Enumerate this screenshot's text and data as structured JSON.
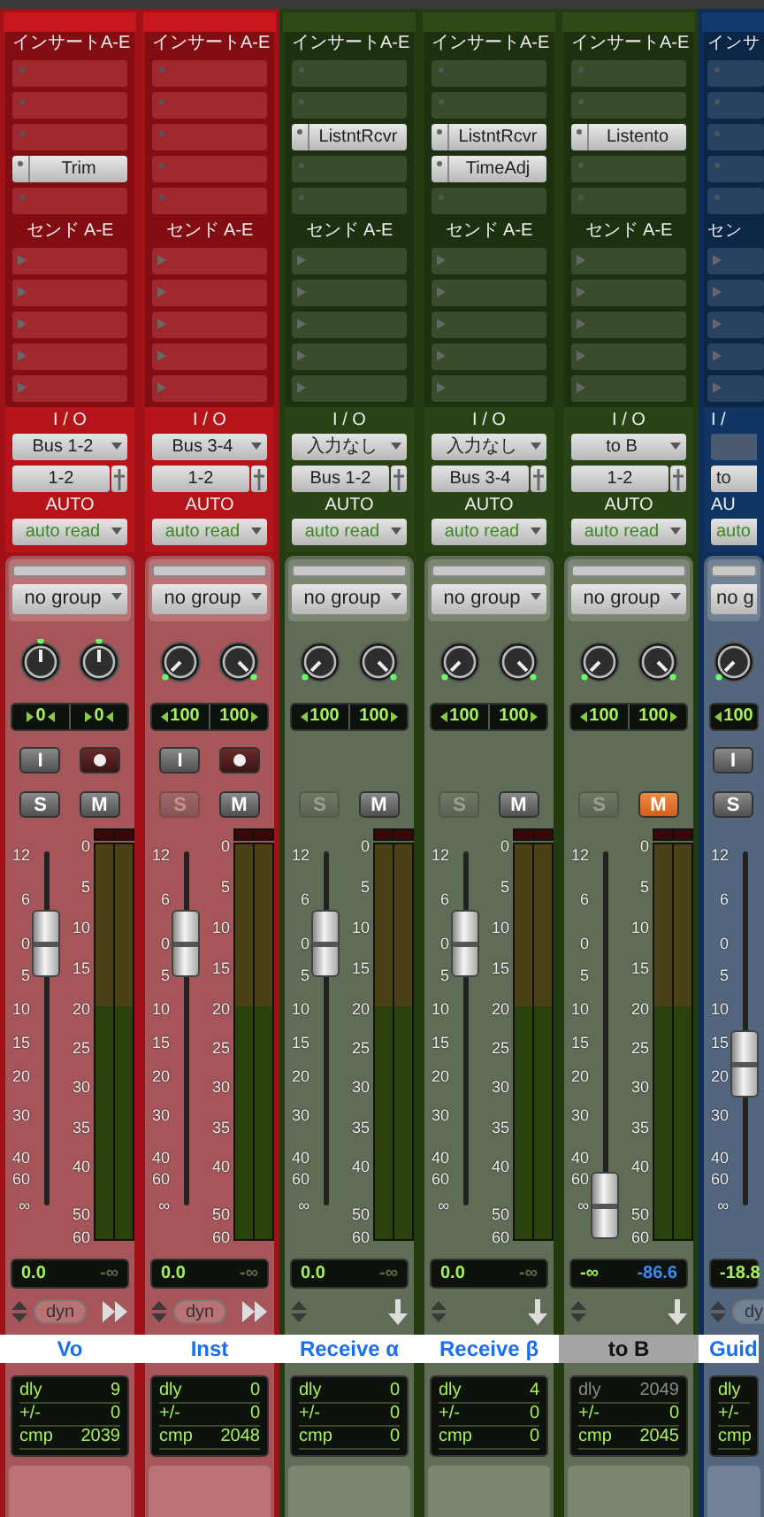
{
  "strips": [
    {
      "color": "#c8161d",
      "inserts_title": "インサートA-E",
      "inserts": [
        {
          "kind": "empty"
        },
        {
          "kind": "empty"
        },
        {
          "kind": "empty"
        },
        {
          "kind": "plugin",
          "label": "Trim"
        },
        {
          "kind": "empty"
        }
      ],
      "sends_title": "センド A-E",
      "sends": [
        {
          "kind": "empty"
        },
        {
          "kind": "empty"
        },
        {
          "kind": "empty"
        },
        {
          "kind": "empty"
        },
        {
          "kind": "empty"
        }
      ],
      "io_title": "I / O",
      "input": "Bus 1-2",
      "output": "1-2",
      "auto_title": "AUTO",
      "auto": "auto read",
      "group": "no group",
      "knobs": [
        {
          "kind": "center"
        },
        {
          "kind": "center"
        }
      ],
      "pan": [
        "0",
        "0"
      ],
      "buttons": [
        {
          "kind": "input",
          "label": "I"
        },
        {
          "kind": "record"
        }
      ],
      "solo": {
        "label": "S",
        "disabled": false
      },
      "mute": {
        "label": "M",
        "on": false
      },
      "fader_scale": [
        "12",
        "6",
        "0",
        "5",
        "10",
        "15",
        "20",
        "30",
        "40",
        "60",
        "∞"
      ],
      "meter_scale": [
        "0",
        "5",
        "10",
        "15",
        "20",
        "25",
        "30",
        "35",
        "40",
        "50",
        "60"
      ],
      "fader": {
        "level": 0.74
      },
      "volume": "0.0",
      "peak": "-∞",
      "peak_dimmed": true,
      "dyn": "dyn",
      "end_icon": {
        "kind": "double_arrow"
      },
      "name": "Vo",
      "selected": true,
      "delay": [
        {
          "label": "dly",
          "value": "9",
          "dimmed": false
        },
        {
          "label": "+/-",
          "value": "0",
          "dimmed": false
        },
        {
          "label": "cmp",
          "value": "2039",
          "dimmed": false
        }
      ]
    },
    {
      "color": "#c8161d",
      "inserts_title": "インサートA-E",
      "inserts": [
        {
          "kind": "empty"
        },
        {
          "kind": "empty"
        },
        {
          "kind": "empty"
        },
        {
          "kind": "empty"
        },
        {
          "kind": "empty"
        }
      ],
      "sends_title": "センド A-E",
      "sends": [
        {
          "kind": "empty"
        },
        {
          "kind": "empty"
        },
        {
          "kind": "empty"
        },
        {
          "kind": "empty"
        },
        {
          "kind": "empty"
        }
      ],
      "io_title": "I / O",
      "input": "Bus 3-4",
      "output": "1-2",
      "auto_title": "AUTO",
      "auto": "auto read",
      "group": "no group",
      "knobs": [
        {
          "kind": "left"
        },
        {
          "kind": "right"
        }
      ],
      "pan": [
        "100",
        "100"
      ],
      "buttons": [
        {
          "kind": "input",
          "label": "I"
        },
        {
          "kind": "record"
        }
      ],
      "solo": {
        "label": "S",
        "disabled": true
      },
      "mute": {
        "label": "M",
        "on": false
      },
      "fader_scale": [
        "12",
        "6",
        "0",
        "5",
        "10",
        "15",
        "20",
        "30",
        "40",
        "60",
        "∞"
      ],
      "meter_scale": [
        "0",
        "5",
        "10",
        "15",
        "20",
        "25",
        "30",
        "35",
        "40",
        "50",
        "60"
      ],
      "fader": {
        "level": 0.74
      },
      "volume": "0.0",
      "peak": "-∞",
      "peak_dimmed": true,
      "dyn": "dyn",
      "end_icon": {
        "kind": "double_arrow"
      },
      "name": "Inst",
      "selected": true,
      "delay": [
        {
          "label": "dly",
          "value": "0",
          "dimmed": false
        },
        {
          "label": "+/-",
          "value": "0",
          "dimmed": false
        },
        {
          "label": "cmp",
          "value": "2048",
          "dimmed": false
        }
      ]
    },
    {
      "color": "#2d4a17",
      "inserts_title": "インサートA-E",
      "inserts": [
        {
          "kind": "empty"
        },
        {
          "kind": "empty"
        },
        {
          "kind": "plugin",
          "label": "ListntRcvr"
        },
        {
          "kind": "empty"
        },
        {
          "kind": "empty"
        }
      ],
      "sends_title": "センド A-E",
      "sends": [
        {
          "kind": "empty"
        },
        {
          "kind": "empty"
        },
        {
          "kind": "empty"
        },
        {
          "kind": "empty"
        },
        {
          "kind": "empty"
        }
      ],
      "io_title": "I / O",
      "input": "入力なし",
      "output": "Bus 1-2",
      "auto_title": "AUTO",
      "auto": "auto read",
      "group": "no group",
      "knobs": [
        {
          "kind": "left"
        },
        {
          "kind": "right"
        }
      ],
      "pan": [
        "100",
        "100"
      ],
      "solo": {
        "label": "S",
        "disabled": true
      },
      "mute": {
        "label": "M",
        "on": false
      },
      "fader_scale": [
        "12",
        "6",
        "0",
        "5",
        "10",
        "15",
        "20",
        "30",
        "40",
        "60",
        "∞"
      ],
      "meter_scale": [
        "0",
        "5",
        "10",
        "15",
        "20",
        "25",
        "30",
        "35",
        "40",
        "50",
        "60"
      ],
      "fader": {
        "level": 0.74
      },
      "volume": "0.0",
      "peak": "-∞",
      "peak_dimmed": true,
      "end_icon": {
        "kind": "down_arrow"
      },
      "name": "Receive α",
      "selected": true,
      "delay": [
        {
          "label": "dly",
          "value": "0",
          "dimmed": false
        },
        {
          "label": "+/-",
          "value": "0",
          "dimmed": false
        },
        {
          "label": "cmp",
          "value": "0",
          "dimmed": false
        }
      ]
    },
    {
      "color": "#2d4a17",
      "inserts_title": "インサートA-E",
      "inserts": [
        {
          "kind": "empty"
        },
        {
          "kind": "empty"
        },
        {
          "kind": "plugin",
          "label": "ListntRcvr"
        },
        {
          "kind": "plugin",
          "label": "TimeAdj"
        },
        {
          "kind": "empty"
        }
      ],
      "sends_title": "センド A-E",
      "sends": [
        {
          "kind": "empty"
        },
        {
          "kind": "empty"
        },
        {
          "kind": "empty"
        },
        {
          "kind": "empty"
        },
        {
          "kind": "empty"
        }
      ],
      "io_title": "I / O",
      "input": "入力なし",
      "output": "Bus 3-4",
      "auto_title": "AUTO",
      "auto": "auto read",
      "group": "no group",
      "knobs": [
        {
          "kind": "left"
        },
        {
          "kind": "right"
        }
      ],
      "pan": [
        "100",
        "100"
      ],
      "solo": {
        "label": "S",
        "disabled": true
      },
      "mute": {
        "label": "M",
        "on": false
      },
      "fader_scale": [
        "12",
        "6",
        "0",
        "5",
        "10",
        "15",
        "20",
        "30",
        "40",
        "60",
        "∞"
      ],
      "meter_scale": [
        "0",
        "5",
        "10",
        "15",
        "20",
        "25",
        "30",
        "35",
        "40",
        "50",
        "60"
      ],
      "fader": {
        "level": 0.74
      },
      "volume": "0.0",
      "peak": "-∞",
      "peak_dimmed": true,
      "end_icon": {
        "kind": "down_arrow"
      },
      "name": "Receive β",
      "selected": true,
      "delay": [
        {
          "label": "dly",
          "value": "4",
          "dimmed": false
        },
        {
          "label": "+/-",
          "value": "0",
          "dimmed": false
        },
        {
          "label": "cmp",
          "value": "0",
          "dimmed": false
        }
      ]
    },
    {
      "color": "#2d4a17",
      "inserts_title": "インサートA-E",
      "inserts": [
        {
          "kind": "empty"
        },
        {
          "kind": "empty"
        },
        {
          "kind": "plugin",
          "label": "Listento"
        },
        {
          "kind": "empty"
        },
        {
          "kind": "empty"
        }
      ],
      "sends_title": "センド A-E",
      "sends": [
        {
          "kind": "empty"
        },
        {
          "kind": "empty"
        },
        {
          "kind": "empty"
        },
        {
          "kind": "empty"
        },
        {
          "kind": "empty"
        }
      ],
      "io_title": "I / O",
      "input": "to B",
      "output": "1-2",
      "auto_title": "AUTO",
      "auto": "auto read",
      "group": "no group",
      "knobs": [
        {
          "kind": "left"
        },
        {
          "kind": "right"
        }
      ],
      "pan": [
        "100",
        "100"
      ],
      "solo": {
        "label": "S",
        "disabled": true
      },
      "mute": {
        "label": "M",
        "on": true
      },
      "fader_scale": [
        "12",
        "6",
        "0",
        "5",
        "10",
        "15",
        "20",
        "30",
        "40",
        "60",
        "∞"
      ],
      "meter_scale": [
        "0",
        "5",
        "10",
        "15",
        "20",
        "25",
        "30",
        "35",
        "40",
        "50",
        "60"
      ],
      "fader": {
        "level": 0
      },
      "volume": "-∞",
      "peak": "-86.6",
      "peak_dimmed": false,
      "end_icon": {
        "kind": "down_arrow"
      },
      "name": "to B",
      "selected": false,
      "delay": [
        {
          "label": "dly",
          "value": "2049",
          "dimmed": true
        },
        {
          "label": "+/-",
          "value": "0",
          "dimmed": false
        },
        {
          "label": "cmp",
          "value": "2045",
          "dimmed": false
        }
      ]
    },
    {
      "color": "#123a6e",
      "inserts_title": "インサ",
      "inserts": [
        {
          "kind": "empty"
        },
        {
          "kind": "empty"
        },
        {
          "kind": "empty"
        },
        {
          "kind": "empty"
        },
        {
          "kind": "empty"
        }
      ],
      "sends_title": "セン",
      "sends": [
        {
          "kind": "empty"
        },
        {
          "kind": "empty"
        },
        {
          "kind": "empty"
        },
        {
          "kind": "empty"
        },
        {
          "kind": "empty"
        }
      ],
      "io_title": "I /",
      "output": "to",
      "auto_title": "AU",
      "auto": "auto",
      "group": "no g",
      "knobs": [
        {
          "kind": "left"
        }
      ],
      "pan": [
        "100"
      ],
      "buttons": [
        {
          "kind": "input",
          "label": "I"
        }
      ],
      "solo": {
        "label": "S",
        "disabled": false
      },
      "fader_scale": [
        "12",
        "6",
        "0",
        "5",
        "10",
        "15",
        "20",
        "30",
        "40",
        "60",
        "∞"
      ],
      "fader": {
        "level": 0.4
      },
      "volume": "-18.8",
      "dyn": "dy",
      "name": "Guid",
      "selected": true,
      "delay": [
        {
          "label": "dly",
          "dimmed": false
        },
        {
          "label": "+/-",
          "dimmed": false
        },
        {
          "label": "cmp",
          "dimmed": false
        }
      ]
    }
  ]
}
